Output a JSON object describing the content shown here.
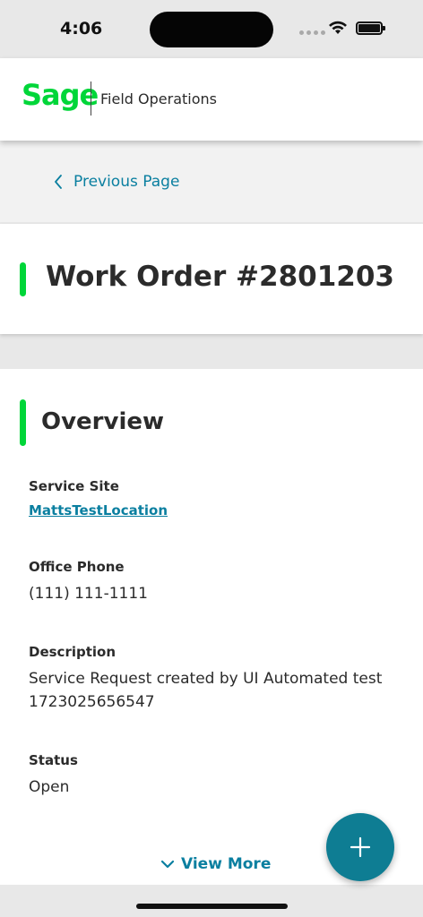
{
  "status_bar": {
    "time": "4:06"
  },
  "header": {
    "brand": "Sage",
    "product": "Field Operations"
  },
  "breadcrumb": {
    "previous_label": "Previous Page"
  },
  "page": {
    "title": "Work Order #2801203"
  },
  "overview": {
    "title": "Overview",
    "service_site_label": "Service Site",
    "service_site_value": "MattsTestLocation",
    "office_phone_label": "Office Phone",
    "office_phone_value": "(111) 111-1111",
    "description_label": "Description",
    "description_value": "Service Request created by UI Automated test 1723025656547",
    "status_label": "Status",
    "status_value": "Open",
    "view_more_label": "View More"
  },
  "colors": {
    "brand_green": "#00d639",
    "link_teal": "#0a7fa0",
    "fab": "#0e7d93"
  },
  "icons": [
    "wifi-icon",
    "battery-icon",
    "chevron-left-icon",
    "chevron-down-icon",
    "plus-icon"
  ]
}
